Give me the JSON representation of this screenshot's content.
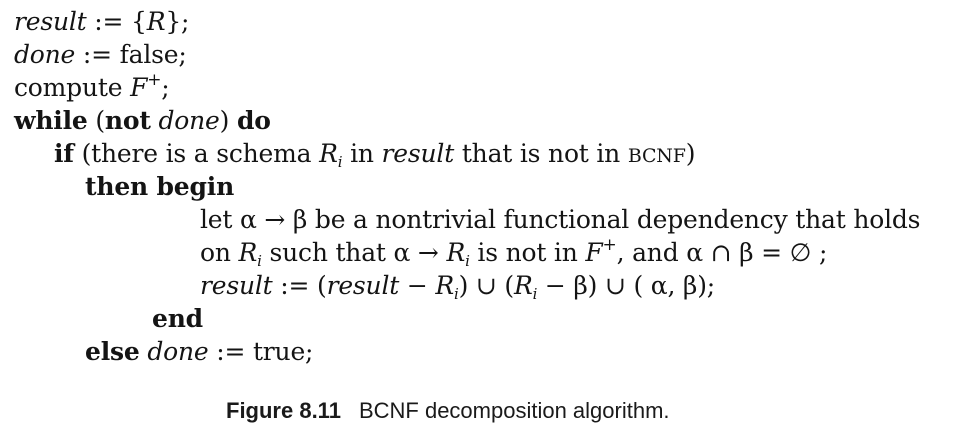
{
  "algorithm": {
    "line1": {
      "var": "result",
      "op": " := {",
      "set_member": "R",
      "end": "};"
    },
    "line2": {
      "var": "done",
      "op": " := false;"
    },
    "line3": {
      "text": "compute ",
      "var": "F",
      "sup": "+",
      "end": ";"
    },
    "line4": {
      "kw_while": "while",
      "open": " (",
      "kw_not": "not",
      "space": " ",
      "var": "done",
      "close": ") ",
      "kw_do": "do"
    },
    "line5": {
      "kw_if": "if",
      "text1": " (there is a schema ",
      "var": "R",
      "sub": "i",
      "text2": " in ",
      "var2": "result",
      "text3": " that is not in ",
      "smallcaps": "BCNF",
      "end": ")"
    },
    "line6": {
      "kw": "then begin"
    },
    "line7": {
      "text": "let α → β be a nontrivial functional dependency that holds"
    },
    "line8": {
      "text1": "on ",
      "var1": "R",
      "sub1": "i",
      "text2": " such that α → ",
      "var2": "R",
      "sub2": "i",
      "text3": " is not in ",
      "var3": "F",
      "sup": "+",
      "text4": ", and α ∩ β = ∅ ;"
    },
    "line9": {
      "var1": "result",
      "op": " := (",
      "var2": "result",
      "minus": " − ",
      "var3": "R",
      "sub1": "i",
      "text1": ") ∪ (",
      "var4": "R",
      "sub2": "i",
      "text2": " − β) ∪ ( α, β);"
    },
    "line10": {
      "kw": "end"
    },
    "line11": {
      "kw_else": "else",
      "space": " ",
      "var": "done",
      "op": " := true;"
    }
  },
  "caption": {
    "label": "Figure 8.11",
    "text": "BCNF decomposition algorithm."
  }
}
